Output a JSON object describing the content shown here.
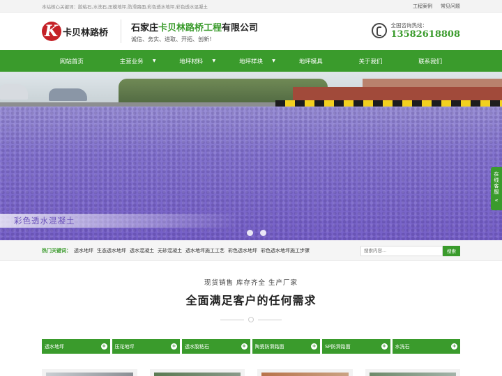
{
  "topbar": {
    "keywords": "本站核心关键词：胶粘石,水洗石,压模地坪,防滑路面,彩色透水地坪,彩色透水混凝土",
    "links": [
      "工程案例",
      "常见问题"
    ]
  },
  "header": {
    "logo_text": "卡贝林路桥",
    "logo_letter": "K",
    "company_prefix": "石家庄",
    "company_highlight": "卡贝林路桥工程",
    "company_suffix": "有限公司",
    "slogan": "诚信、务实、进取、开拓、创新！",
    "hotline_label": "全国咨询热线：",
    "hotline_number": "13582618808"
  },
  "nav": {
    "items": [
      {
        "label": "网站首页",
        "has_dropdown": false
      },
      {
        "label": "主营业务",
        "has_dropdown": true
      },
      {
        "label": "地坪材料",
        "has_dropdown": true
      },
      {
        "label": "地坪样块",
        "has_dropdown": true
      },
      {
        "label": "地坪模具",
        "has_dropdown": false
      },
      {
        "label": "关于我们",
        "has_dropdown": false
      },
      {
        "label": "联系我们",
        "has_dropdown": false
      }
    ],
    "caret": "▼"
  },
  "banner": {
    "caption": "彩色透水混凝土",
    "slides": 2
  },
  "side_consult": {
    "label": "在线客服",
    "chevron": "«"
  },
  "hotbar": {
    "label": "热门关键词：",
    "keywords": [
      "透水地坪",
      "生态透水地坪",
      "透水混凝土",
      "无砂混凝土",
      "透水地坪施工工艺",
      "彩色透水地坪",
      "彩色透水地坪施工步骤"
    ],
    "search_placeholder": "搜索内容...",
    "search_button": "搜索"
  },
  "section": {
    "subtitle": "现货销售 库存齐全 生产厂家",
    "title": "全面满足客户的任何需求"
  },
  "tabs": [
    {
      "label": "透水地坪",
      "icon": "+"
    },
    {
      "label": "压花地坪",
      "icon": "+"
    },
    {
      "label": "透水胶粘石",
      "icon": "+"
    },
    {
      "label": "陶瓷防滑路面",
      "icon": "+"
    },
    {
      "label": "SP防滑路面",
      "icon": "+"
    },
    {
      "label": "水洗石",
      "icon": "+"
    }
  ],
  "colors": {
    "brand_green": "#3a9b2c",
    "logo_red": "#c52127"
  }
}
